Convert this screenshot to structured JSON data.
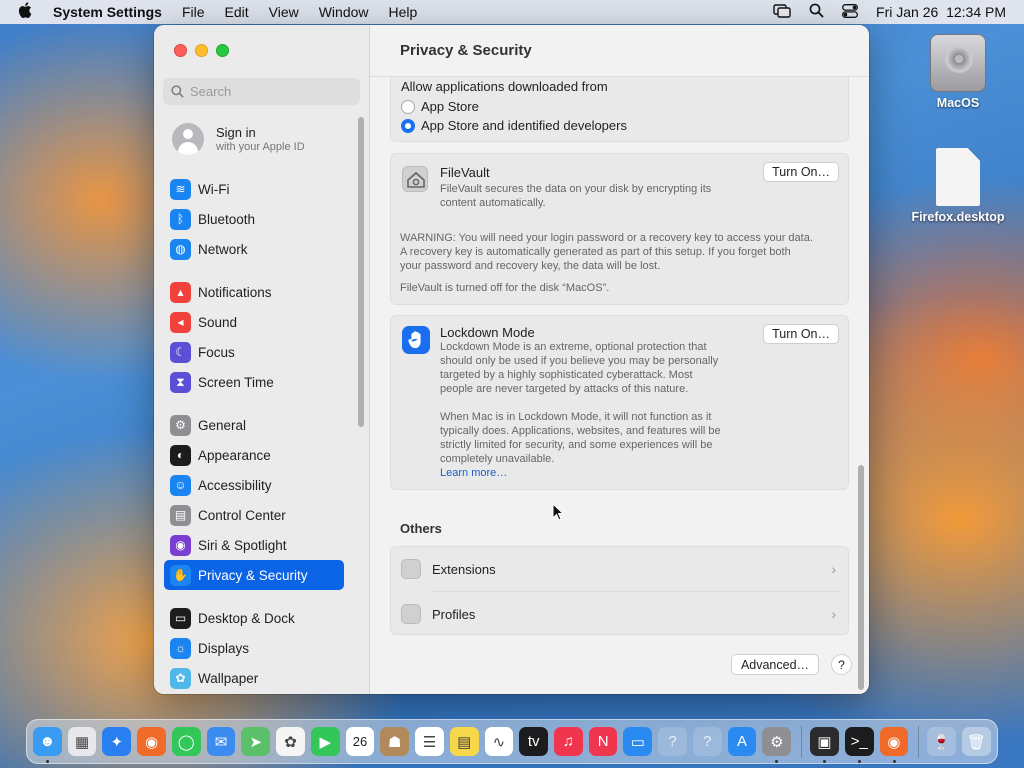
{
  "menubar": {
    "app_name": "System Settings",
    "menus": [
      "File",
      "Edit",
      "View",
      "Window",
      "Help"
    ],
    "datetime": "Fri Jan 26  12:34 PM"
  },
  "desktop": {
    "icons": [
      {
        "label": "MacOS",
        "type": "disk"
      },
      {
        "label": "Firefox.desktop",
        "type": "document"
      }
    ]
  },
  "window": {
    "title": "Privacy & Security",
    "search_placeholder": "Search",
    "account": {
      "name": "Sign in",
      "subtitle": "with your Apple ID"
    },
    "sidebar_groups": [
      [
        {
          "label": "Wi-Fi",
          "icon": "wifi-icon",
          "color": "#1a84f0",
          "glyph": "≋"
        },
        {
          "label": "Bluetooth",
          "icon": "bluetooth-icon",
          "color": "#1a84f0",
          "glyph": "ᛒ"
        },
        {
          "label": "Network",
          "icon": "globe-icon",
          "color": "#1a84f0",
          "glyph": "◍"
        }
      ],
      [
        {
          "label": "Notifications",
          "icon": "bell-icon",
          "color": "#f0413a",
          "glyph": "▴"
        },
        {
          "label": "Sound",
          "icon": "speaker-icon",
          "color": "#f0413a",
          "glyph": "◂"
        },
        {
          "label": "Focus",
          "icon": "moon-icon",
          "color": "#5a4fd6",
          "glyph": "☾"
        },
        {
          "label": "Screen Time",
          "icon": "hourglass-icon",
          "color": "#5a4fd6",
          "glyph": "⧗"
        }
      ],
      [
        {
          "label": "General",
          "icon": "gear-icon",
          "color": "#8e8e93",
          "glyph": "⚙"
        },
        {
          "label": "Appearance",
          "icon": "appearance-icon",
          "color": "#1c1c1e",
          "glyph": "◐"
        },
        {
          "label": "Accessibility",
          "icon": "accessibility-icon",
          "color": "#1a84f0",
          "glyph": "☺"
        },
        {
          "label": "Control Center",
          "icon": "control-center-icon",
          "color": "#8e8e93",
          "glyph": "▤"
        },
        {
          "label": "Siri & Spotlight",
          "icon": "siri-icon",
          "color": "#7a3fd0",
          "glyph": "◉"
        },
        {
          "label": "Privacy & Security",
          "icon": "hand-icon",
          "color": "#1a84f0",
          "glyph": "✋",
          "active": true
        }
      ],
      [
        {
          "label": "Desktop & Dock",
          "icon": "dock-icon",
          "color": "#1c1c1e",
          "glyph": "▭"
        },
        {
          "label": "Displays",
          "icon": "sun-icon",
          "color": "#1a84f0",
          "glyph": "☼"
        },
        {
          "label": "Wallpaper",
          "icon": "wallpaper-icon",
          "color": "#4fb8e8",
          "glyph": "✿"
        }
      ]
    ],
    "allow_apps": {
      "heading": "Allow applications downloaded from",
      "options": [
        {
          "label": "App Store",
          "selected": false
        },
        {
          "label": "App Store and identified developers",
          "selected": true
        }
      ]
    },
    "filevault": {
      "title": "FileVault",
      "description_lines": [
        "FileVault secures the data on your disk by encrypting its",
        "content automatically."
      ],
      "button": "Turn On…",
      "warning_lines": [
        "WARNING: You will need your login password or a recovery key to access your data.",
        "A recovery key is automatically generated as part of this setup. If you forget both",
        "your password and recovery key, the data will be lost."
      ],
      "status": "FileVault is turned off for the disk “MacOS”."
    },
    "lockdown": {
      "title": "Lockdown Mode",
      "description_lines": [
        "Lockdown Mode is an extreme, optional protection that",
        "should only be used if you believe you may be personally",
        "targeted by a highly sophisticated cyberattack. Most",
        "people are never targeted by attacks of this nature."
      ],
      "description2_lines": [
        "When Mac is in Lockdown Mode, it will not function as it",
        "typically does. Applications, websites, and features will be",
        "strictly limited for security, and some experiences will be",
        "completely unavailable."
      ],
      "learn_more": "Learn more…",
      "button": "Turn On…"
    },
    "others": {
      "heading": "Others",
      "rows": [
        {
          "label": "Extensions",
          "icon": "extensions-icon"
        },
        {
          "label": "Profiles",
          "icon": "profiles-icon"
        }
      ]
    },
    "advanced_button": "Advanced…",
    "help_button": "?"
  },
  "dock": {
    "apps": [
      {
        "name": "finder-icon",
        "color": "#3a9bf2",
        "glyph": "☻",
        "running": true
      },
      {
        "name": "launchpad-icon",
        "color": "#e8e8ec",
        "glyph": "▦",
        "running": false
      },
      {
        "name": "safari-icon",
        "color": "#2a7ff0",
        "glyph": "✦",
        "running": false
      },
      {
        "name": "firefox-icon",
        "color": "#f06a2a",
        "glyph": "◉",
        "running": false
      },
      {
        "name": "messages-icon",
        "color": "#33c75a",
        "glyph": "◯",
        "running": false
      },
      {
        "name": "mail-icon",
        "color": "#3a8cf0",
        "glyph": "✉",
        "running": false
      },
      {
        "name": "maps-icon",
        "color": "#5cbf6a",
        "glyph": "➤",
        "running": false
      },
      {
        "name": "photos-icon",
        "color": "#f5f5f5",
        "glyph": "✿",
        "running": false
      },
      {
        "name": "facetime-icon",
        "color": "#33c75a",
        "glyph": "▶",
        "running": false
      },
      {
        "name": "calendar-icon",
        "color": "#ffffff",
        "glyph": "26",
        "running": false
      },
      {
        "name": "contacts-icon",
        "color": "#b08a5a",
        "glyph": "☗",
        "running": false
      },
      {
        "name": "reminders-icon",
        "color": "#ffffff",
        "glyph": "☰",
        "running": false
      },
      {
        "name": "notes-icon",
        "color": "#f7d74a",
        "glyph": "▤",
        "running": false
      },
      {
        "name": "freeform-icon",
        "color": "#ffffff",
        "glyph": "∿",
        "running": false
      },
      {
        "name": "apple-tv-icon",
        "color": "#1c1c1e",
        "glyph": "tv",
        "running": false
      },
      {
        "name": "music-icon",
        "color": "#f0364f",
        "glyph": "♫",
        "running": false
      },
      {
        "name": "news-icon",
        "color": "#f0364f",
        "glyph": "N",
        "running": false
      },
      {
        "name": "keynote-icon",
        "color": "#2a8af0",
        "glyph": "▭",
        "running": false
      },
      {
        "name": "placeholder-app-1-icon",
        "color": "rgba(255,255,255,0.15)",
        "glyph": "?",
        "running": false
      },
      {
        "name": "placeholder-app-2-icon",
        "color": "rgba(255,255,255,0.15)",
        "glyph": "?",
        "running": false
      },
      {
        "name": "app-store-icon",
        "color": "#2a8af0",
        "glyph": "A",
        "running": false
      },
      {
        "name": "system-settings-icon",
        "color": "#8e8e93",
        "glyph": "⚙",
        "running": true
      }
    ],
    "apps_right": [
      {
        "name": "screenshot-icon",
        "color": "#2b2b2e",
        "glyph": "▣",
        "running": true
      },
      {
        "name": "terminal-icon",
        "color": "#1c1c1e",
        "glyph": ">_",
        "running": true
      },
      {
        "name": "firefox-running-icon",
        "color": "#f06a2a",
        "glyph": "◉",
        "running": true
      }
    ],
    "apps_extra": [
      {
        "name": "wine-icon",
        "color": "rgba(255,255,255,0.2)",
        "glyph": "🍷",
        "running": false
      },
      {
        "name": "trash-icon",
        "color": "rgba(255,255,255,0.35)",
        "glyph": "🗑",
        "running": false
      }
    ]
  }
}
